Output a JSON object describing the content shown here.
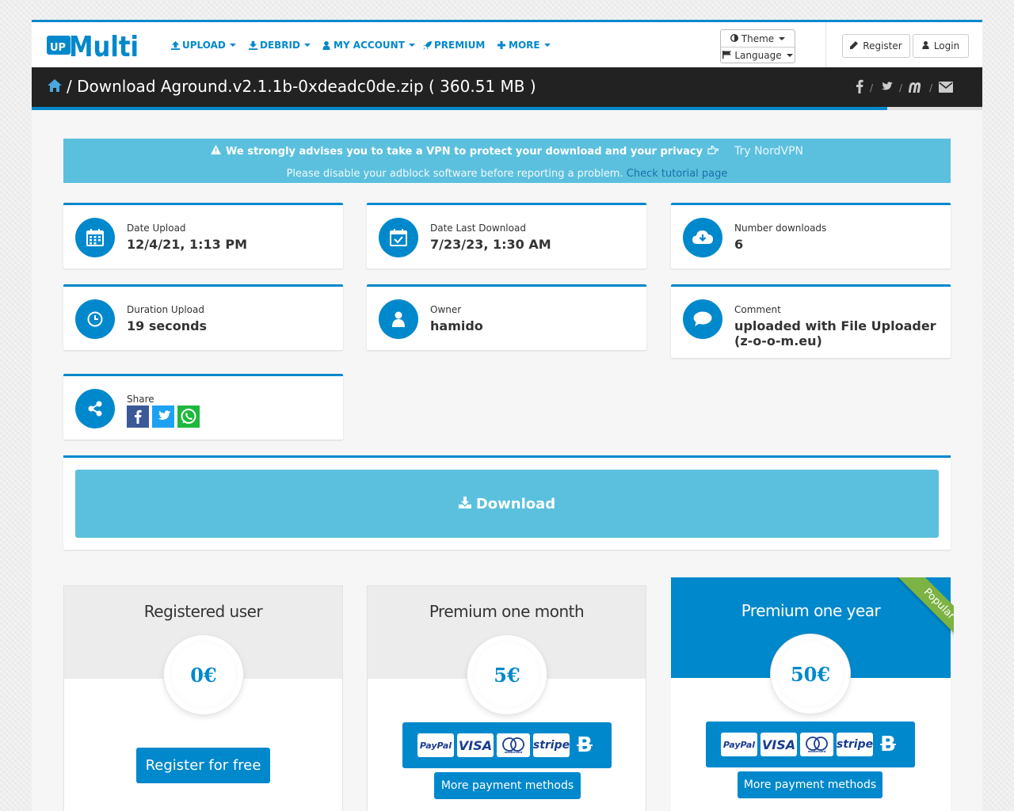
{
  "brand": {
    "logo_up": "UP",
    "logo_text": "Multi"
  },
  "nav": {
    "items": [
      {
        "label": "UPLOAD",
        "icon": "upload-icon"
      },
      {
        "label": "DEBRID",
        "icon": "download-icon"
      },
      {
        "label": "MY ACCOUNT",
        "icon": "user-icon"
      },
      {
        "label": "PREMIUM",
        "icon": "rocket-icon"
      },
      {
        "label": "MORE",
        "icon": "plus-icon"
      }
    ],
    "theme_label": "Theme",
    "language_label": "Language",
    "register_label": "Register",
    "login_label": "Login"
  },
  "page": {
    "title": "/ Download Aground.v2.1.1b-0xdeadc0de.zip ( 360.51 MB )",
    "social": [
      "facebook-icon",
      "twitter-icon",
      "mastodon-icon",
      "mail-icon"
    ],
    "progress_fraction": 0.9
  },
  "alert": {
    "vpn_text": "We strongly advises you to take a VPN to protect your download and your privacy",
    "vpn_link": "Try NordVPN",
    "adblock_text": "Please disable your adblock software before reporting a problem.",
    "tutorial_link": "Check tutorial page"
  },
  "info": {
    "date_upload": {
      "label": "Date Upload",
      "value": "12/4/21, 1:13 PM"
    },
    "date_last_download": {
      "label": "Date Last Download",
      "value": "7/23/23, 1:30 AM"
    },
    "number_downloads": {
      "label": "Number downloads",
      "value": "6"
    },
    "duration_upload": {
      "label": "Duration Upload",
      "value": "19 seconds"
    },
    "owner": {
      "label": "Owner",
      "value": "hamido"
    },
    "comment": {
      "label": "Comment",
      "value": "uploaded with File Uploader (z-o-o-m.eu)"
    },
    "share": {
      "label": "Share"
    }
  },
  "download": {
    "label": "Download"
  },
  "pricing": [
    {
      "name": "Registered user",
      "price": "0€",
      "button": "Register for free"
    },
    {
      "name": "Premium one month",
      "price": "5€",
      "button": "More payment methods"
    },
    {
      "name": "Premium one year",
      "price": "50€",
      "button": "More payment methods",
      "badge": "Popular"
    }
  ],
  "payment": {
    "paypal": "PayPal",
    "visa": "VISA",
    "mastercard": "mastercard",
    "stripe": "stripe",
    "bitcoin": "B"
  },
  "colors": {
    "primary": "#0088cc",
    "info": "#5bc0de",
    "dark": "#222222",
    "ribbon": "#7cb342"
  }
}
